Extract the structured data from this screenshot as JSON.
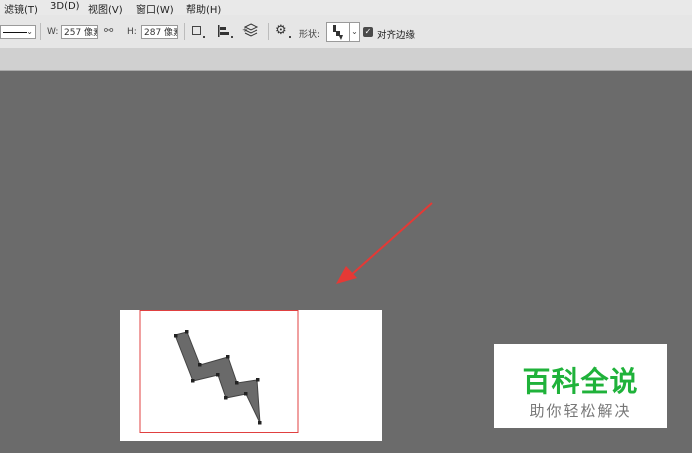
{
  "menu": {
    "items": [
      "滤镜(T)",
      "3D(D)",
      "视图(V)",
      "窗口(W)",
      "帮助(H)"
    ]
  },
  "options": {
    "w_label": "W:",
    "w_value": "257 像素",
    "h_label": "H:",
    "h_value": "287 像素",
    "shape_label": "形状:",
    "align_edges_label": "对齐边缘",
    "align_edges_checked": true
  },
  "watermark": {
    "title": "百科全说",
    "subtitle": "助你轻松解决",
    "title_color": "#1fb23a"
  },
  "colors": {
    "canvas_bg": "#6b6b6b",
    "arrow": "#e53935",
    "selection_box": "#e04040",
    "shape_fill": "#6a6a6a"
  }
}
